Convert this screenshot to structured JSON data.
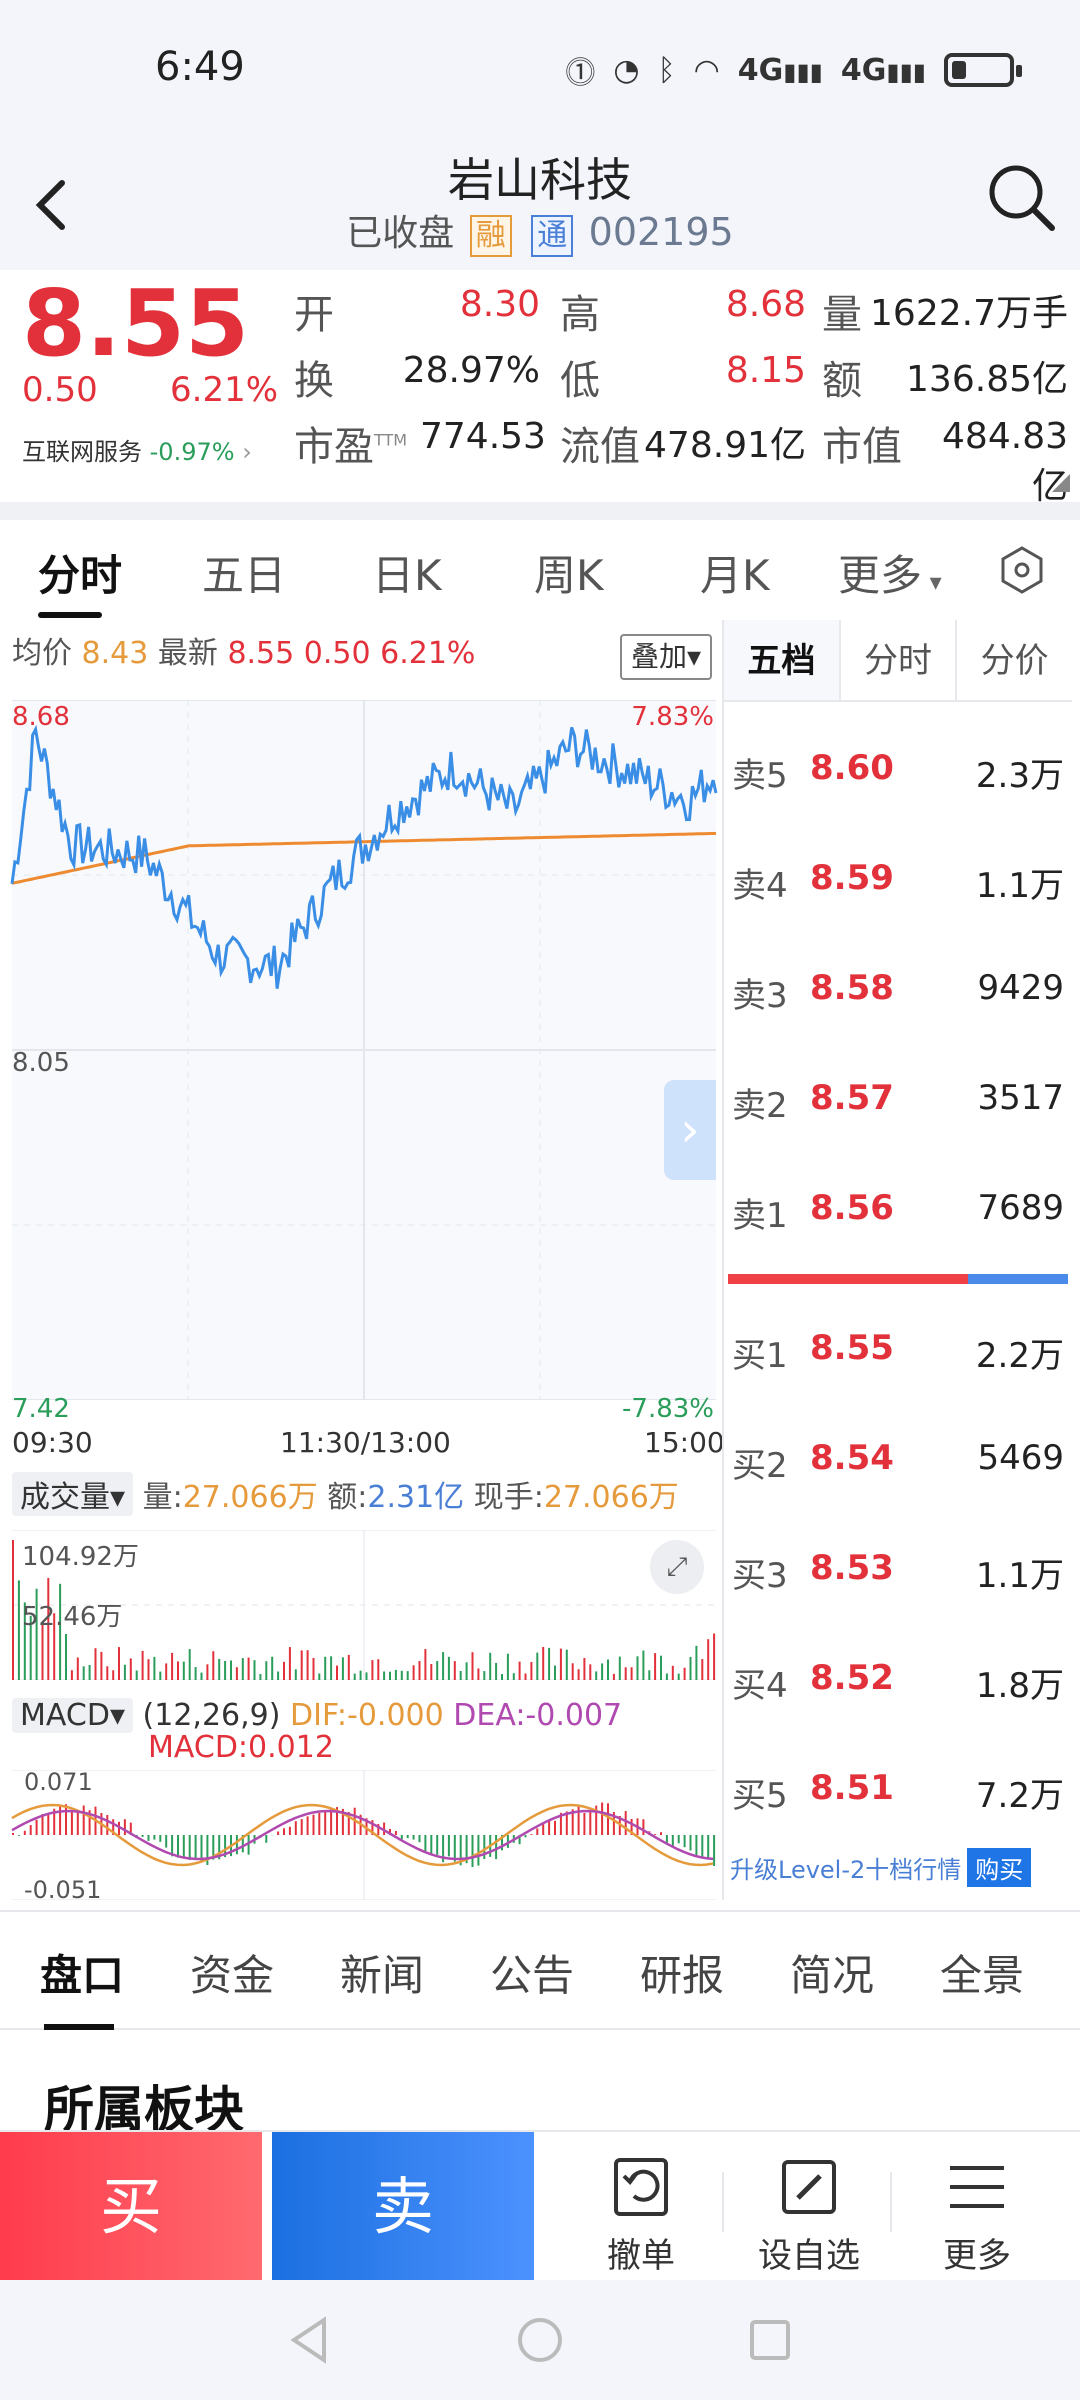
{
  "status": {
    "time": "6:49",
    "net1": "4G",
    "net2": "4G"
  },
  "header": {
    "title": "岩山科技",
    "state": "已收盘",
    "badge_rong": "融",
    "badge_tong": "通",
    "code": "002195"
  },
  "quote": {
    "price": "8.55",
    "change": "0.50",
    "change_pct": "6.21%",
    "sector_name": "互联网服务",
    "sector_chg": "-0.97%",
    "open_lbl": "开",
    "open": "8.30",
    "high_lbl": "高",
    "high": "8.68",
    "vol_lbl": "量",
    "vol": "1622.7万手",
    "turn_lbl": "换",
    "turn": "28.97%",
    "low_lbl": "低",
    "low": "8.15",
    "amt_lbl": "额",
    "amt": "136.85亿",
    "pe_lbl": "市盈",
    "pe_sup": "TTM",
    "pe": "774.53",
    "float_lbl": "流值",
    "float": "478.91亿",
    "mcap_lbl": "市值",
    "mcap": "484.83亿"
  },
  "chart_tabs": {
    "t1": "分时",
    "t2": "五日",
    "t3": "日K",
    "t4": "周K",
    "t5": "月K",
    "t6": "更多"
  },
  "intraday": {
    "avg_lbl": "均价",
    "avg": "8.43",
    "latest_lbl": "最新",
    "latest": "8.55",
    "chg": "0.50",
    "pct": "6.21%",
    "overlay": "叠加",
    "y_top": "8.68",
    "y_mid": "8.05",
    "y_bot": "7.42",
    "pct_top": "7.83%",
    "pct_bot": "-7.83%",
    "x1": "09:30",
    "x2": "11:30/13:00",
    "x3": "15:00"
  },
  "volume": {
    "selector": "成交量",
    "vol_lbl": "量:",
    "vol": "27.066万",
    "amt_lbl": "额:",
    "amt": "2.31亿",
    "hand_lbl": "现手:",
    "hand": "27.066万",
    "y1": "104.92万",
    "y2": "52.46万"
  },
  "macd": {
    "selector": "MACD",
    "params": "(12,26,9)",
    "dif": "DIF:-0.000",
    "dea": "DEA:-0.007",
    "macd": "MACD:0.012",
    "y_top": "0.071",
    "y_bot": "-0.051"
  },
  "book": {
    "tabs": [
      "五档",
      "分时",
      "分价"
    ],
    "asks": [
      {
        "lbl": "卖5",
        "px": "8.60",
        "qty": "2.3万"
      },
      {
        "lbl": "卖4",
        "px": "8.59",
        "qty": "1.1万"
      },
      {
        "lbl": "卖3",
        "px": "8.58",
        "qty": "9429"
      },
      {
        "lbl": "卖2",
        "px": "8.57",
        "qty": "3517"
      },
      {
        "lbl": "卖1",
        "px": "8.56",
        "qty": "7689"
      }
    ],
    "bids": [
      {
        "lbl": "买1",
        "px": "8.55",
        "qty": "2.2万"
      },
      {
        "lbl": "买2",
        "px": "8.54",
        "qty": "5469"
      },
      {
        "lbl": "买3",
        "px": "8.53",
        "qty": "1.1万"
      },
      {
        "lbl": "买4",
        "px": "8.52",
        "qty": "1.8万"
      },
      {
        "lbl": "买5",
        "px": "8.51",
        "qty": "7.2万"
      }
    ],
    "upgrade": "升级Level-2十档行情",
    "buy_chip": "购买"
  },
  "bottom_tabs": [
    "盘口",
    "资金",
    "新闻",
    "公告",
    "研报",
    "简况",
    "全景"
  ],
  "section_title": "所属板块",
  "actions": {
    "buy": "买",
    "sell": "卖",
    "cancel": "撤单",
    "watch": "设自选",
    "more": "更多"
  },
  "colors": {
    "up": "#e2313a",
    "down": "#2a9d5a",
    "price_line": "#3a8ee6",
    "avg_line": "#ee8a2f"
  }
}
